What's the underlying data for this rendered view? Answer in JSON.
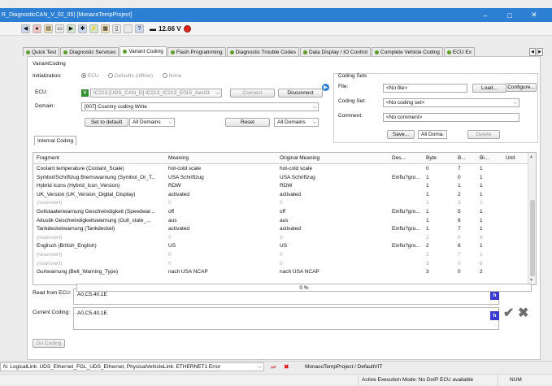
{
  "window": {
    "title": "R_DiagnosticCAN_V_02_05) [MonacoTempProject]",
    "minimize": "–",
    "maximize": "□",
    "close": "✕"
  },
  "toolbar": {
    "voltage": "12.66 V"
  },
  "tabs": [
    {
      "label": "Quick Test",
      "active": false
    },
    {
      "label": "Diagnostic Services",
      "active": false
    },
    {
      "label": "Variant Coding",
      "active": true
    },
    {
      "label": "Flash Programming",
      "active": false
    },
    {
      "label": "Diagnostic Trouble Codes",
      "active": false
    },
    {
      "label": "Data Display / IO Control",
      "active": false
    },
    {
      "label": "Complete Vehicle Coding",
      "active": false
    },
    {
      "label": "ECU Ex",
      "active": false
    }
  ],
  "variant_coding": {
    "group_label": "VariantCoding",
    "init_label": "Initialization:",
    "init_options": [
      "ECU",
      "Defaults (offline)",
      "None"
    ],
    "ecu_label": "ECU:",
    "ecu_value": "IC213 [UDS_CAN_D] IC213_IC213_E015_AeU1t",
    "ecu_badge": "V",
    "connect": "Connect",
    "disconnect": "Disconnect",
    "domain_label": "Domain:",
    "domain_value": "[007] Country coding Write",
    "set_to_default": "Set to default",
    "all_domains_left": "All Domains",
    "reset": "Reset",
    "all_domains_right": "All Domains"
  },
  "coding_sets": {
    "group_label": "Coding Sets",
    "file_label": "File:",
    "file_value": "<No file>",
    "load": "Load...",
    "configure": "Configure...",
    "set_label": "Coding Set:",
    "set_value": "<No coding set>",
    "comment_label": "Comment:",
    "comment_value": "<No comment>",
    "save": "Save...",
    "all_domains": "All Doma",
    "delete": "Delete"
  },
  "internal_tab": "Internal Coding",
  "grid": {
    "headers": [
      "Fragment",
      "Meaning",
      "Original Meaning",
      "Des...",
      "Byte",
      "B...",
      "Bi...",
      "Unit"
    ],
    "rows": [
      {
        "fragment": "Coolant temperature (Coolant_Scale)",
        "meaning": "hot-cold scale",
        "orig": "hot-cold scale",
        "des": "",
        "byte": "0",
        "b": "7",
        "bi": "1",
        "res": false
      },
      {
        "fragment": "Symbol/Schriftzug Bremswarnung (Symbol_Or_T...",
        "meaning": "USA Schriftzug",
        "orig": "USA Schriftzug",
        "des": "Einflu?gro...",
        "byte": "1",
        "b": "0",
        "bi": "1",
        "res": false
      },
      {
        "fragment": "Hybrid Icons (Hybrid_Icon_Version)",
        "meaning": "RDW",
        "orig": "RDW",
        "des": "",
        "byte": "1",
        "b": "1",
        "bi": "1",
        "res": false
      },
      {
        "fragment": "UK_Version (UK_Version_Digital_Display)",
        "meaning": "activated",
        "orig": "activated",
        "des": "",
        "byte": "1",
        "b": "2",
        "bi": "1",
        "res": false
      },
      {
        "fragment": "(reserviert)",
        "meaning": "0",
        "orig": "0",
        "des": "",
        "byte": "1",
        "b": "3",
        "bi": "2",
        "res": true
      },
      {
        "fragment": "Gollstaatenwarnung Geschwindigkeit (Speedwar...",
        "meaning": "off",
        "orig": "off",
        "des": "Einflu?gro...",
        "byte": "1",
        "b": "5",
        "bi": "1",
        "res": false
      },
      {
        "fragment": "Akustik Geschwindigkeitswarnung (Gull_state_...",
        "meaning": "aus",
        "orig": "aus",
        "des": "",
        "byte": "1",
        "b": "6",
        "bi": "1",
        "res": false
      },
      {
        "fragment": "Tankdeckelwarnung (Tankdeckel)",
        "meaning": "activated",
        "orig": "activated",
        "des": "Einflu?gro...",
        "byte": "1",
        "b": "7",
        "bi": "1",
        "res": false
      },
      {
        "fragment": "(reserviert)",
        "meaning": "0",
        "orig": "0",
        "des": "",
        "byte": "2",
        "b": "0",
        "bi": "6",
        "res": true
      },
      {
        "fragment": "Englisch (British_English)",
        "meaning": "US",
        "orig": "US",
        "des": "Einflu?gro...",
        "byte": "2",
        "b": "6",
        "bi": "1",
        "res": false
      },
      {
        "fragment": "(reserviert)",
        "meaning": "0",
        "orig": "0",
        "des": "",
        "byte": "2",
        "b": "7",
        "bi": "1",
        "res": true
      },
      {
        "fragment": "(reserviert)",
        "meaning": "0",
        "orig": "0",
        "des": "",
        "byte": "3",
        "b": "0",
        "bi": "8",
        "res": true
      },
      {
        "fragment": "Gurtwarnung (Belt_Warning_Type)",
        "meaning": "nach USA NCAP",
        "orig": "nach USA NCAP",
        "des": "",
        "byte": "3",
        "b": "0",
        "bi": "2",
        "res": false
      }
    ]
  },
  "read_from_ecu": {
    "label": "Read from ECU:",
    "value": "A0,C5,40,1E",
    "hbtn": "h"
  },
  "current_coding": {
    "label": "Current Coding:",
    "value": "A0,C5,40,1E",
    "hbtn": "h"
  },
  "do_coding": "Do Coding",
  "progress_text": "0 %",
  "status1": {
    "link": "N: LogicalLink: UDS_Ethernet_FGL_UDS_Ethernet, PhysicalVehicleLink: ETHERNET1 Error",
    "project": "MonacoTempProject / DefaultVIT"
  },
  "status2": {
    "mode": "Active Execution Mode: No DoIP ECU available",
    "num": "NUM"
  }
}
